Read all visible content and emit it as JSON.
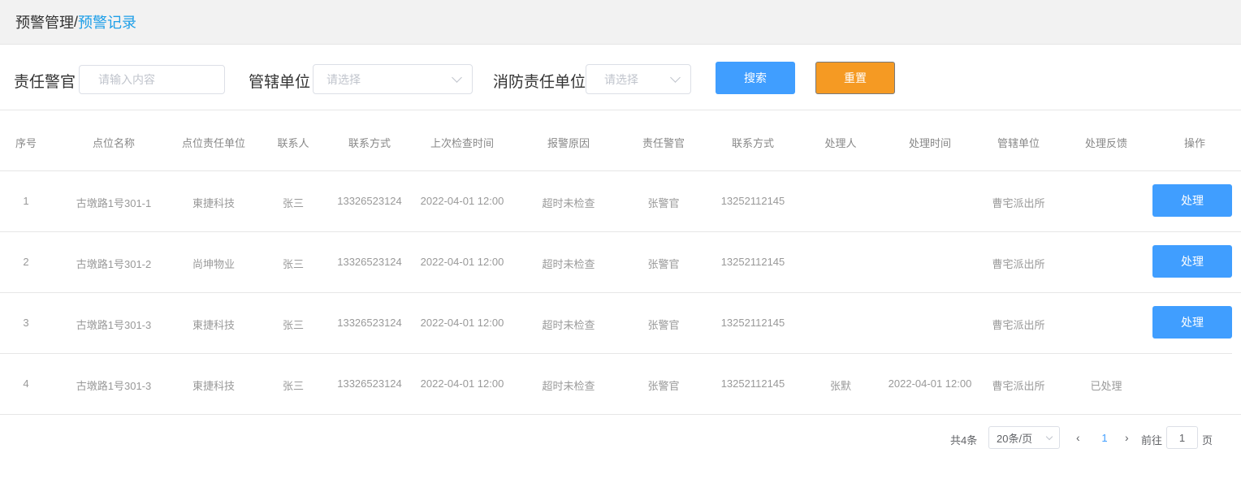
{
  "breadcrumb": {
    "parent": "预警管理",
    "separator": "/",
    "current": "预警记录"
  },
  "filters": {
    "officer_label": "责任警官",
    "officer_placeholder": "请输入内容",
    "unit_label": "管辖单位",
    "unit_placeholder": "请选择",
    "fire_unit_label": "消防责任单位",
    "fire_unit_placeholder": "请选择",
    "search_label": "搜索",
    "reset_label": "重置"
  },
  "colors": {
    "primary": "#409eff",
    "reset": "#f59a23",
    "link": "#1e9fe8"
  },
  "table": {
    "headers": [
      "序号",
      "点位名称",
      "点位责任单位",
      "联系人",
      "联系方式",
      "上次检查时间",
      "报警原因",
      "责任警官",
      "联系方式",
      "处理人",
      "处理时间",
      "管辖单位",
      "处理反馈",
      "操作"
    ],
    "rows": [
      {
        "no": "1",
        "site": "古墩路1号301-1",
        "unit": "東捷科技",
        "contact": "张三",
        "phone": "13326523124",
        "last_check": "2022-04-01 12:00",
        "reason": "超时未检查",
        "officer": "张警官",
        "officer_phone": "13252112145",
        "handler": "",
        "handle_time": "",
        "station": "曹宅派出所",
        "feedback": "",
        "action": "处理"
      },
      {
        "no": "2",
        "site": "古墩路1号301-2",
        "unit": "尚坤物业",
        "contact": "张三",
        "phone": "13326523124",
        "last_check": "2022-04-01 12:00",
        "reason": "超时未检查",
        "officer": "张警官",
        "officer_phone": "13252112145",
        "handler": "",
        "handle_time": "",
        "station": "曹宅派出所",
        "feedback": "",
        "action": "处理"
      },
      {
        "no": "3",
        "site": "古墩路1号301-3",
        "unit": "東捷科技",
        "contact": "张三",
        "phone": "13326523124",
        "last_check": "2022-04-01 12:00",
        "reason": "超时未检查",
        "officer": "张警官",
        "officer_phone": "13252112145",
        "handler": "",
        "handle_time": "",
        "station": "曹宅派出所",
        "feedback": "",
        "action": "处理"
      },
      {
        "no": "4",
        "site": "古墩路1号301-3",
        "unit": "東捷科技",
        "contact": "张三",
        "phone": "13326523124",
        "last_check": "2022-04-01 12:00",
        "reason": "超时未检查",
        "officer": "张警官",
        "officer_phone": "13252112145",
        "handler": "张默",
        "handle_time": "2022-04-01 12:00",
        "station": "曹宅派出所",
        "feedback": "已处理",
        "action": ""
      }
    ]
  },
  "pagination": {
    "total": "共4条",
    "page_size": "20条/页",
    "prev_icon": "chevron-left-icon",
    "current_page": "1",
    "next_icon": "chevron-right-icon",
    "goto_prefix": "前往",
    "goto_value": "1",
    "goto_suffix": "页"
  }
}
